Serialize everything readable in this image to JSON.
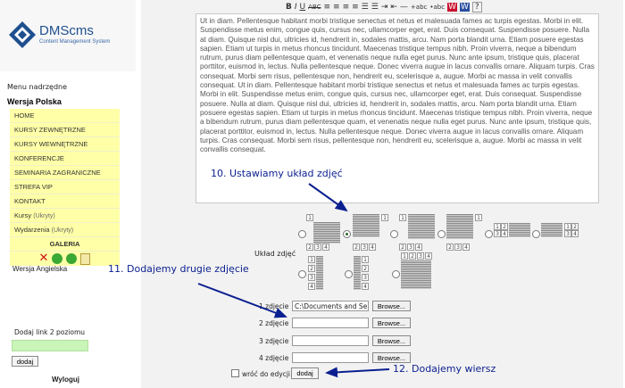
{
  "logo": {
    "title": "DMScms",
    "subtitle": "Content Management System"
  },
  "sidebar": {
    "menu_header": "Menu nadrzędne",
    "section_title": "Wersja Polska",
    "items": [
      {
        "label": "HOME"
      },
      {
        "label": "KURSY ZEWNĘTRZNE"
      },
      {
        "label": "KURSY WEWNĘTRZNE"
      },
      {
        "label": "KONFERENCJE"
      },
      {
        "label": "SEMINARIA ZAGRANICZNE"
      },
      {
        "label": "STREFA VIP"
      },
      {
        "label": "KONTAKT"
      },
      {
        "label": "Kursy",
        "suffix": "(Ukryty)"
      },
      {
        "label": "Wydarzenia",
        "suffix": "(Ukryty)"
      },
      {
        "label": "GALERIA"
      }
    ],
    "english": "Wersja Angielska",
    "add_label": "Dodaj link 2 poziomu",
    "add_button": "dodaj",
    "logout": "Wyloguj"
  },
  "toolbar": {
    "buttons": [
      "B",
      "I",
      "U",
      "ABC",
      "≡",
      "≡",
      "≡",
      "≡",
      "☰",
      "☰",
      "⇥",
      "⇤",
      "—",
      "+abc",
      "•abc",
      "W",
      "W",
      "?"
    ]
  },
  "editor": {
    "text": "Ut in diam. Pellentesque habitant morbi tristique senectus et netus et malesuada fames ac turpis egestas. Morbi in elit. Suspendisse metus enim, congue quis, cursus nec, ullamcorper eget, erat. Duis consequat. Suspendisse posuere. Nulla at diam. Quisque nisl dui, ultricies id, hendrerit in, sodales mattis, arcu. Nam porta blandit urna. Etiam posuere egestas sapien. Etiam ut turpis in metus rhoncus tincidunt. Maecenas tristique tempus nibh. Proin viverra, neque a bibendum rutrum, purus diam pellentesque quam, et venenatis neque nulla eget purus. Nunc ante ipsum, tristique quis, placerat porttitor, euismod in, lectus. Nulla pellentesque neque. Donec viverra augue in lacus convallis ornare. Aliquam turpis. Cras consequat. Morbi sem risus, pellentesque non, hendrerit eu, scelerisque a, augue. Morbi ac massa in velit convallis consequat. Ut in diam. Pellentesque habitant morbi tristique senectus et netus et malesuada fames ac turpis egestas. Morbi in elit. Suspendisse metus enim, congue quis, cursus nec, ullamcorper eget, erat. Duis consequat. Suspendisse posuere. Nulla at diam. Quisque nisl dui, ultricies id, hendrerit in, sodales mattis, arcu. Nam porta blandit urna. Etiam posuere egestas sapien. Etiam ut turpis in metus rhoncus tincidunt. Maecenas tristique tempus nibh. Proin viverra, neque a bibendum rutrum, purus diam pellentesque quam, et venenatis neque nulla eget purus. Nunc ante ipsum, tristique quis, placerat porttitor, euismod in, lectus. Nulla pellentesque neque. Donec viverra augue in lacus convallis ornare. Aliquam turpis. Cras consequat. Morbi sem risus, pellentesque non, hendrerit eu, scelerisque a, augue. Morbi ac massa in velit convallis consequat."
  },
  "layout": {
    "label": "Układ zdjęć"
  },
  "photos": [
    {
      "label": "1 zdjęcie",
      "value": "C:\\Documents and Se",
      "browse": "Browse..."
    },
    {
      "label": "2 zdjęcie",
      "value": "",
      "browse": "Browse..."
    },
    {
      "label": "3 zdjęcie",
      "value": "",
      "browse": "Browse..."
    },
    {
      "label": "4 zdjęcie",
      "value": "",
      "browse": "Browse..."
    }
  ],
  "back_label": "wróć do edycji",
  "add_row_button": "dodaj",
  "annotations": {
    "a10": "10. Ustawiamy układ zdjęć",
    "a11": "11. Dodajemy drugie zdjęcie",
    "a12": "12. Dodajemy wiersz"
  },
  "colors": {
    "accent_blue": "#0a1f8f",
    "menu_bg": "#ffffa8",
    "input_green": "#c9f5b8"
  }
}
